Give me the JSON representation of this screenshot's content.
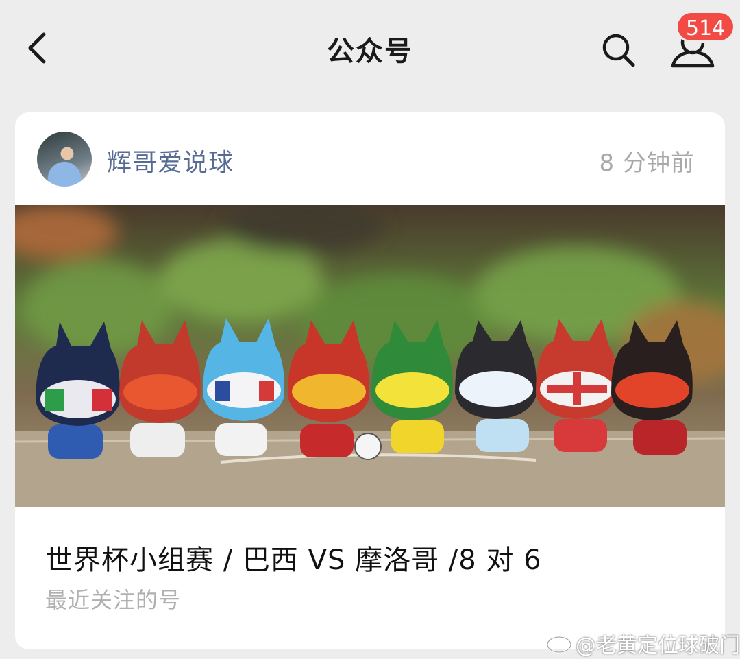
{
  "header": {
    "title": "公众号",
    "badge_count": "514",
    "back_icon": "chevron-left-icon",
    "search_icon": "search-icon",
    "profile_icon": "person-icon"
  },
  "card": {
    "author_name": "辉哥爱说球",
    "time": "8 分钟前",
    "article_title": "世界杯小组赛 / 巴西 VS 摩洛哥 /8 对 6",
    "subtitle": "最近关注的号"
  },
  "watermark": {
    "text": "@老黄定位球破门",
    "icon": "weibo-icon"
  },
  "colors": {
    "badge": "#f24a44",
    "author": "#576b95",
    "background": "#ededed"
  }
}
